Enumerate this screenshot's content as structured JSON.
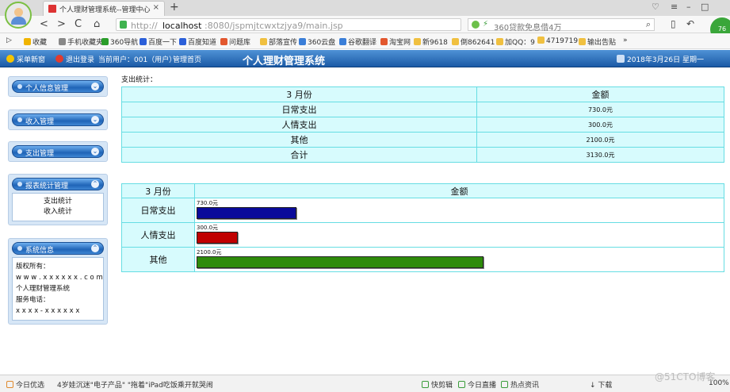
{
  "browser": {
    "tab_title": "个人理财管理系统--管理中心",
    "tab_close": "×",
    "new_tab": "+",
    "nav": {
      "back": "<",
      "forward": ">",
      "reload": "C",
      "home": "⌂"
    },
    "url": {
      "proto": "http://",
      "host": "localhost",
      "path": ":8080/jspmjtcwxtzjya9/main.jsp"
    },
    "search_placeholder": "360贷款免息借4万",
    "badge": "76",
    "bookmarks": [
      "收藏",
      "手机收藏夹",
      "360导航",
      "百度一下",
      "百度知道",
      "问题库",
      "部落宣传",
      "360云盘",
      "谷歌翻译",
      "淘宝网",
      "新9618",
      "倒862641",
      "加QQ：9",
      "4719719",
      "输出告贴",
      "»"
    ]
  },
  "app": {
    "header": {
      "new_window": "采单新窗",
      "logout": "退出登录",
      "current_user": "当前用户：001（用户）",
      "admin_home": "管理首页",
      "title": "个人理财管理系统",
      "date": "2018年3月26日 星期一"
    },
    "menu": {
      "personal_info": "个人信息管理",
      "income_mgmt": "收入管理",
      "expense_mgmt": "支出管理",
      "report_mgmt": "报表统计管理",
      "report_links": [
        "支出统计",
        "收入统计"
      ],
      "system_info": "系统信息",
      "info_lines": [
        "版权所有：",
        "w w w . x x x x x x . c o m",
        "个人理财管理系统",
        "服务电话：",
        "x x x x - x x x x x x"
      ]
    },
    "caption": "支出统计：",
    "summary_table": {
      "headers": [
        "3 月份",
        "金额"
      ],
      "rows": [
        {
          "label": "日常支出",
          "amount": "730.0元"
        },
        {
          "label": "人情支出",
          "amount": "300.0元"
        },
        {
          "label": "其他",
          "amount": "2100.0元"
        },
        {
          "label": "合计",
          "amount": "3130.0元"
        }
      ]
    }
  },
  "chart_data": {
    "type": "bar",
    "orientation": "horizontal",
    "title": "",
    "headers": [
      "3 月份",
      "金额"
    ],
    "categories": [
      "日常支出",
      "人情支出",
      "其他"
    ],
    "values": [
      730,
      300,
      2100
    ],
    "value_labels": [
      "730.0元",
      "300.0元",
      "2100.0元"
    ],
    "colors": [
      "#0a0a9a",
      "#c00000",
      "#2e8b0a"
    ],
    "max": 3130,
    "unit": "元"
  },
  "statusbar": {
    "items": [
      "今日优选",
      "4岁娃沉迷\"电子产品\" \"拖着\"iPad吃饭乘开就哭闹",
      "快剪辑",
      "今日直播",
      "热点资讯",
      "下载",
      "100%"
    ],
    "watermark": "@51CTO博客"
  }
}
